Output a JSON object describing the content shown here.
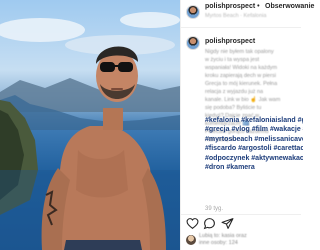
{
  "header": {
    "username": "polishprospect",
    "separator": "•",
    "follow_label": "Obserwowanie",
    "location": "Myrtos Beach · Kefalonia"
  },
  "caption": {
    "username": "polishprospect",
    "blurred_lines": [
      "Nigdy nie byłem tak opalony",
      "w życiu i ta wyspa jest",
      "wspaniała! Widoki na każdym",
      "kroku zapierają dech w piersi",
      "Grecja to mój kierunek. Pełna",
      "relacja z wyjazdu już na",
      "kanale. Link w bio ☝ Jak wam",
      "się podoba? Byliście tu",
      "kiedyś? Dajcie znać w",
      "komentarzach! 🇬🇷",
      "Polecam gorąco każdemu",
      "i tak dalej ☀"
    ]
  },
  "hashtags": [
    "#kefalonia #kefaloniaisland #greece",
    "#grecja #vlog #film #wakacje #w",
    "#myrtosbeach #melissanicave #a",
    "#fiscardo #argostoli #carettacaretta",
    "#odpoczynek #aktywnewakacje",
    "#dron #kamera"
  ],
  "time_ago": "39 tyg.",
  "likes_text_line1": "Lubią to: kasia oraz",
  "likes_text_line2": "inne osoby: 124",
  "icons": [
    "heart-icon",
    "comment-icon",
    "share-icon"
  ]
}
